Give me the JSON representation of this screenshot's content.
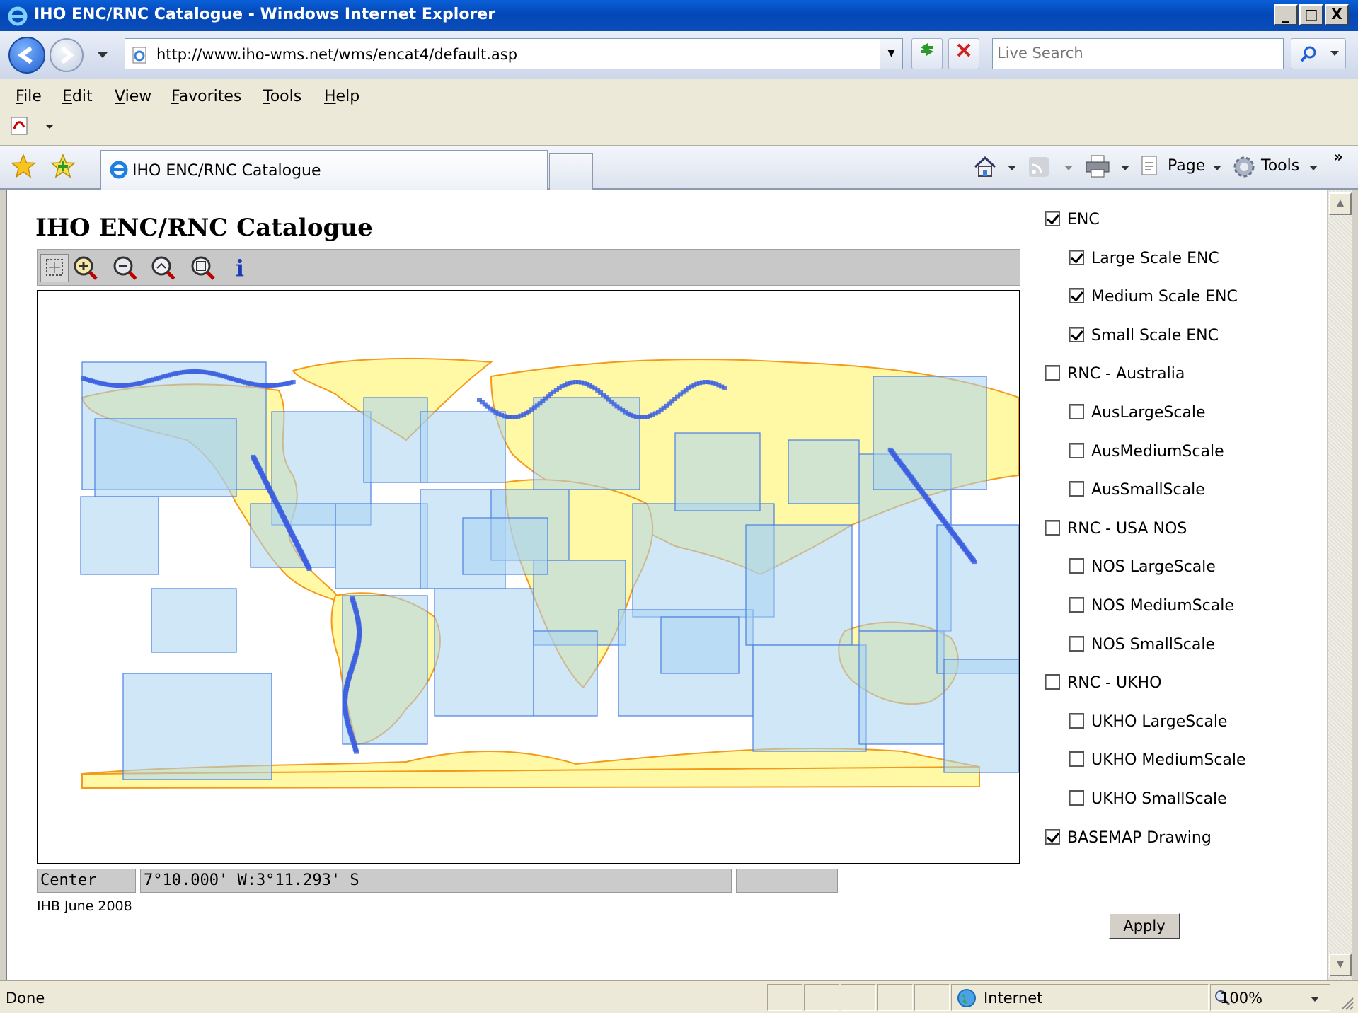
{
  "window": {
    "title": "IHO ENC/RNC Catalogue - Windows Internet Explorer",
    "controls": {
      "minimize": "_",
      "maximize": "□",
      "close": "X"
    }
  },
  "navigation": {
    "url": "http://www.iho-wms.net/wms/encat4/default.asp",
    "search_placeholder": "Live Search"
  },
  "menu": {
    "items": [
      {
        "key": "file",
        "label": "File"
      },
      {
        "key": "edit",
        "label": "Edit"
      },
      {
        "key": "view",
        "label": "View"
      },
      {
        "key": "favorites",
        "label": "Favorites"
      },
      {
        "key": "tools",
        "label": "Tools"
      },
      {
        "key": "help",
        "label": "Help"
      }
    ]
  },
  "tabs": {
    "active_title": "IHO ENC/RNC Catalogue"
  },
  "command_bar": {
    "page_label": "Page",
    "tools_label": "Tools",
    "chevron": "»"
  },
  "page": {
    "title": "IHO ENC/RNC Catalogue",
    "toolbar_tools": [
      "select-box",
      "zoom-in",
      "zoom-out",
      "zoom-previous",
      "zoom-full-extent",
      "info"
    ],
    "info_glyph": "i",
    "coord_label": "Center",
    "coord_value": "7°10.000' W:3°11.293' S",
    "footer": "IHB June 2008",
    "apply_label": "Apply",
    "layers": [
      {
        "label": "ENC",
        "checked": true,
        "indent": 0
      },
      {
        "label": "Large Scale ENC",
        "checked": true,
        "indent": 1
      },
      {
        "label": "Medium Scale ENC",
        "checked": true,
        "indent": 1
      },
      {
        "label": "Small Scale ENC",
        "checked": true,
        "indent": 1
      },
      {
        "label": "RNC - Australia",
        "checked": false,
        "indent": 0
      },
      {
        "label": "AusLargeScale",
        "checked": false,
        "indent": 1
      },
      {
        "label": "AusMediumScale",
        "checked": false,
        "indent": 1
      },
      {
        "label": "AusSmallScale",
        "checked": false,
        "indent": 1
      },
      {
        "label": "RNC - USA NOS",
        "checked": false,
        "indent": 0
      },
      {
        "label": "NOS LargeScale",
        "checked": false,
        "indent": 1
      },
      {
        "label": "NOS MediumScale",
        "checked": false,
        "indent": 1
      },
      {
        "label": "NOS SmallScale",
        "checked": false,
        "indent": 1
      },
      {
        "label": "RNC - UKHO",
        "checked": false,
        "indent": 0
      },
      {
        "label": "UKHO LargeScale",
        "checked": false,
        "indent": 1
      },
      {
        "label": "UKHO MediumScale",
        "checked": false,
        "indent": 1
      },
      {
        "label": "UKHO SmallScale",
        "checked": false,
        "indent": 1
      },
      {
        "label": "BASEMAP Drawing",
        "checked": true,
        "indent": 0
      }
    ]
  },
  "map_colors": {
    "land": "#fff9a6",
    "land_border": "#f39a1c",
    "coverage_fill": "#a9d4f2",
    "coverage_stroke": "#4d7fe0",
    "dense_coverage": "#3b5fe0"
  },
  "status": {
    "text": "Done",
    "zone": "Internet",
    "zoom": "100%"
  }
}
